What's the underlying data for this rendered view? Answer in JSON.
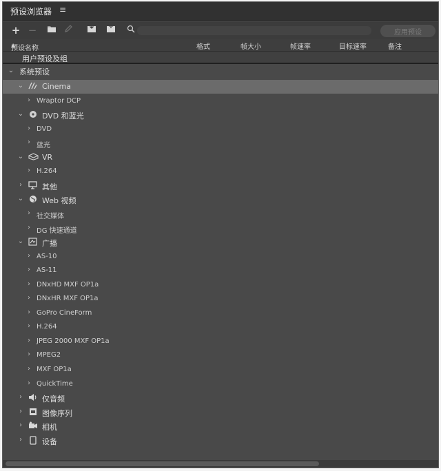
{
  "panel": {
    "title": "预设浏览器",
    "menu_icon": "hamburger-menu-icon"
  },
  "toolbar": {
    "icons": [
      "add-icon",
      "remove-icon",
      "new-folder-icon",
      "edit-icon",
      "import-icon",
      "export-icon"
    ],
    "search_placeholder": "",
    "apply_label": "应用预设"
  },
  "columns": {
    "name": "预设名称",
    "format": "格式",
    "frame_size": "帧大小",
    "frame_rate": "帧速率",
    "target_rate": "目标速率",
    "comment": "备注"
  },
  "user_presets": "用户预设及组",
  "tree": [
    {
      "label": "系统预设",
      "level": 0,
      "expanded": true,
      "icon": ""
    },
    {
      "label": "Cinema",
      "level": 1,
      "expanded": true,
      "icon": "cinema-icon",
      "selected": true
    },
    {
      "label": "Wraptor DCP",
      "level": 2,
      "expanded": false,
      "icon": ""
    },
    {
      "label": "DVD 和蓝光",
      "level": 1,
      "expanded": true,
      "icon": "disc-icon"
    },
    {
      "label": "DVD",
      "level": 2,
      "expanded": false,
      "icon": ""
    },
    {
      "label": "蓝光",
      "level": 2,
      "expanded": false,
      "icon": ""
    },
    {
      "label": "VR",
      "level": 1,
      "expanded": true,
      "icon": "vr-headset-icon"
    },
    {
      "label": "H.264",
      "level": 2,
      "expanded": false,
      "icon": ""
    },
    {
      "label": "其他",
      "level": 1,
      "expanded": false,
      "icon": "monitor-icon"
    },
    {
      "label": "Web 视频",
      "level": 1,
      "expanded": true,
      "icon": "web-globe-icon"
    },
    {
      "label": "社交媒体",
      "level": 2,
      "expanded": false,
      "icon": ""
    },
    {
      "label": "DG 快速通道",
      "level": 2,
      "expanded": false,
      "icon": ""
    },
    {
      "label": "广播",
      "level": 1,
      "expanded": true,
      "icon": "broadcast-icon"
    },
    {
      "label": "AS-10",
      "level": 2,
      "expanded": false,
      "icon": ""
    },
    {
      "label": "AS-11",
      "level": 2,
      "expanded": false,
      "icon": ""
    },
    {
      "label": "DNxHD MXF OP1a",
      "level": 2,
      "expanded": false,
      "icon": ""
    },
    {
      "label": "DNxHR MXF OP1a",
      "level": 2,
      "expanded": false,
      "icon": ""
    },
    {
      "label": "GoPro CineForm",
      "level": 2,
      "expanded": false,
      "icon": ""
    },
    {
      "label": "H.264",
      "level": 2,
      "expanded": false,
      "icon": ""
    },
    {
      "label": "JPEG 2000 MXF OP1a",
      "level": 2,
      "expanded": false,
      "icon": ""
    },
    {
      "label": "MPEG2",
      "level": 2,
      "expanded": false,
      "icon": ""
    },
    {
      "label": "MXF OP1a",
      "level": 2,
      "expanded": false,
      "icon": ""
    },
    {
      "label": "QuickTime",
      "level": 2,
      "expanded": false,
      "icon": ""
    },
    {
      "label": "仅音频",
      "level": 1,
      "expanded": false,
      "icon": "speaker-icon"
    },
    {
      "label": "图像序列",
      "level": 1,
      "expanded": false,
      "icon": "image-sequence-icon"
    },
    {
      "label": "相机",
      "level": 1,
      "expanded": false,
      "icon": "camera-icon"
    },
    {
      "label": "设备",
      "level": 1,
      "expanded": false,
      "icon": "mobile-device-icon"
    }
  ]
}
